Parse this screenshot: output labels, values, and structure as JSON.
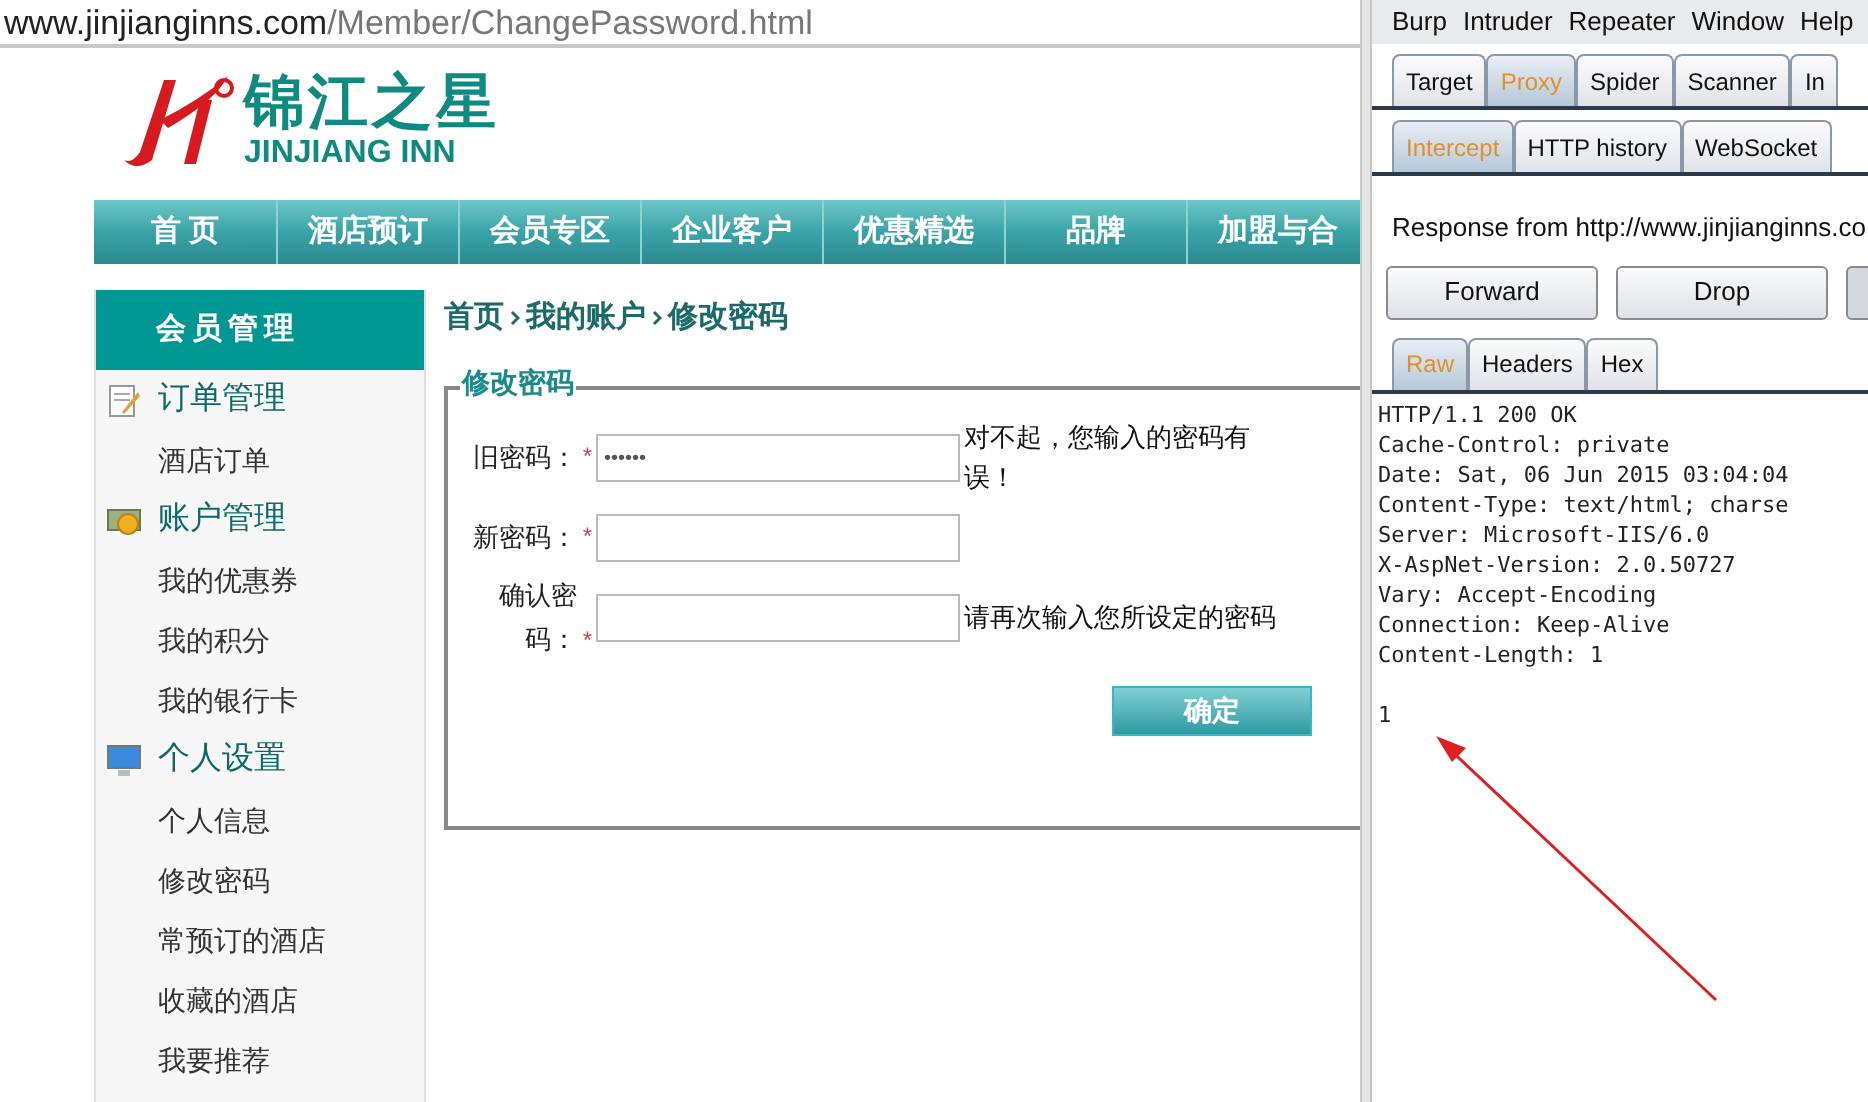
{
  "address_bar": {
    "host": "www.jinjianginns.com",
    "path": "/Member/ChangePassword.html"
  },
  "logo": {
    "name": "锦江之星",
    "subtitle": "JINJIANG INN"
  },
  "nav": [
    {
      "label": "首 页"
    },
    {
      "label": "酒店预订"
    },
    {
      "label": "会员专区"
    },
    {
      "label": "企业客户"
    },
    {
      "label": "优惠精选"
    },
    {
      "label": "品牌"
    },
    {
      "label": "加盟与合"
    }
  ],
  "sidebar": {
    "title": "会员管理",
    "groups": [
      {
        "label": "订单管理",
        "kind": "orders",
        "children": [
          {
            "label": "酒店订单"
          }
        ]
      },
      {
        "label": "账户管理",
        "kind": "account",
        "children": [
          {
            "label": "我的优惠券"
          },
          {
            "label": "我的积分"
          },
          {
            "label": "我的银行卡"
          }
        ]
      },
      {
        "label": "个人设置",
        "kind": "settings",
        "children": [
          {
            "label": "个人信息"
          },
          {
            "label": "修改密码"
          },
          {
            "label": "常预订的酒店"
          },
          {
            "label": "收藏的酒店"
          },
          {
            "label": "我要推荐"
          }
        ]
      }
    ]
  },
  "breadcrumb": [
    "首页",
    "我的账户",
    "修改密码"
  ],
  "form": {
    "legend": "修改密码",
    "fields": [
      {
        "label": "旧密码：",
        "required_mark": "*",
        "value": "••••••",
        "message": "对不起，您输入的密码有误！"
      },
      {
        "label": "新密码：",
        "required_mark": "*"
      },
      {
        "label": "确认密码：",
        "required_mark": "*",
        "message": "请再次输入您所设定的密码"
      }
    ],
    "submit": "确定"
  },
  "burp": {
    "menu": [
      "Burp",
      "Intruder",
      "Repeater",
      "Window",
      "Help"
    ],
    "tabs": [
      {
        "label": "Target",
        "selected": false
      },
      {
        "label": "Proxy",
        "selected": true
      },
      {
        "label": "Spider",
        "selected": false
      },
      {
        "label": "Scanner",
        "selected": false
      },
      {
        "label": "In",
        "selected": false
      }
    ],
    "subtabs": [
      {
        "label": "Intercept",
        "selected": true
      },
      {
        "label": "HTTP history",
        "selected": false
      },
      {
        "label": "WebSocket",
        "selected": false
      }
    ],
    "info": "Response from http://www.jinjianginns.co",
    "buttons": [
      "Forward",
      "Drop"
    ],
    "view_tabs": [
      {
        "label": "Raw",
        "selected": true
      },
      {
        "label": "Headers",
        "selected": false
      },
      {
        "label": "Hex",
        "selected": false
      }
    ],
    "response_lines": [
      "HTTP/1.1 200 OK",
      "Cache-Control: private",
      "Date: Sat, 06 Jun 2015 03:04:04",
      "Content-Type: text/html; charse",
      "Server: Microsoft-IIS/6.0",
      "X-AspNet-Version: 2.0.50727",
      "Vary: Accept-Encoding",
      "Connection: Keep-Alive",
      "Content-Length: 1"
    ],
    "response_body": "1"
  }
}
